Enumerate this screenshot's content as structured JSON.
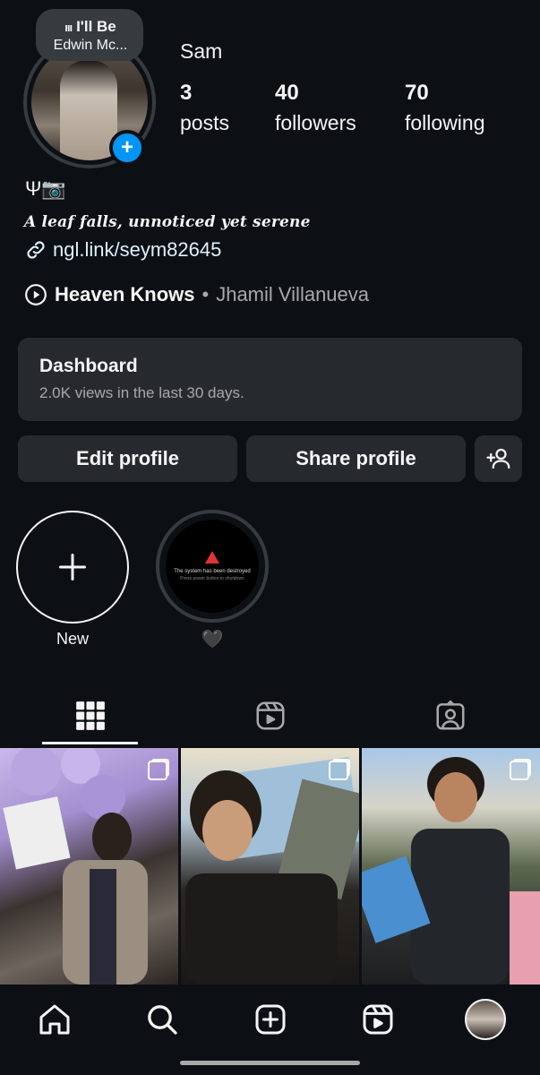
{
  "note": {
    "bars": "ııı",
    "title": "I'll Be",
    "artist": "Edwin Mc..."
  },
  "profile": {
    "username": "Sam",
    "posts_count": "3",
    "posts_label": "posts",
    "followers_count": "40",
    "followers_label": "followers",
    "following_count": "70",
    "following_label": "following",
    "emoji_line": "Ψ📷",
    "bio": "A leaf falls, unnoticed yet serene",
    "link": "ngl.link/seym82645",
    "music_song": "Heaven Knows",
    "music_separator": "•",
    "music_artist": "Jhamil Villanueva"
  },
  "dashboard": {
    "title": "Dashboard",
    "subtitle": "2.0K views in the last 30 days."
  },
  "buttons": {
    "edit": "Edit profile",
    "share": "Share profile"
  },
  "highlights": [
    {
      "label": "New"
    },
    {
      "label": "🖤",
      "cover_line1": "The system has been destroyed",
      "cover_line2": "Press power button to shutdown"
    }
  ],
  "colors": {
    "background": "#0c1014",
    "card": "#262a2f",
    "accent": "#0095f6",
    "link": "#e0f1ff",
    "muted": "#a8a8a8"
  },
  "icons": {
    "tabs": [
      "grid-icon",
      "reels-icon",
      "tagged-icon"
    ],
    "nav": [
      "home-icon",
      "search-icon",
      "create-icon",
      "reels-icon",
      "profile-avatar"
    ],
    "discover": "add-person-icon"
  }
}
